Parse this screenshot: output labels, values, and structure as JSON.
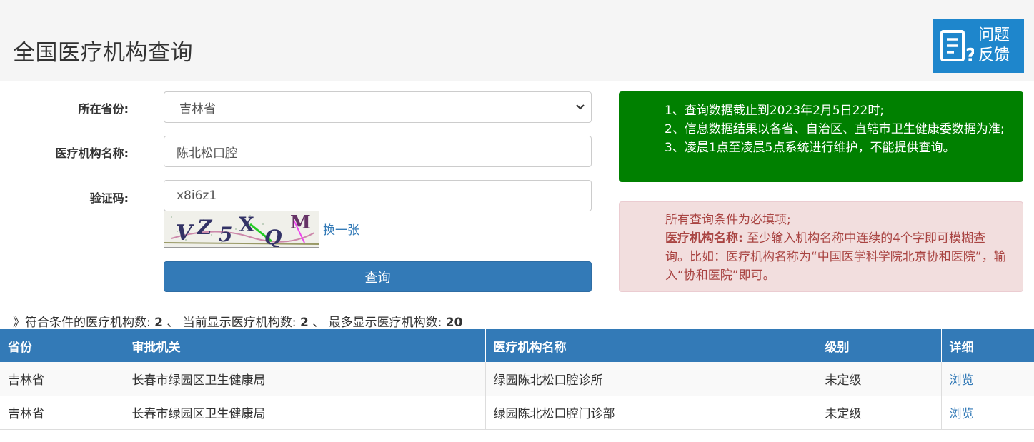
{
  "header": {
    "title": "全国医疗机构查询",
    "feedback_line1": "问题",
    "feedback_line2": "反馈"
  },
  "form": {
    "province_label": "所在省份:",
    "province_value": "吉林省",
    "name_label": "医疗机构名称:",
    "name_value": "陈北松口腔",
    "captcha_label": "验证码:",
    "captcha_value": "x8i6z1",
    "captcha_image_text": [
      "V",
      "Z",
      "5",
      "X",
      "Q",
      "M"
    ],
    "refresh_label": "换一张",
    "submit_label": "查询"
  },
  "notice_info": {
    "line1": "1、查询数据截止到2023年2月5日22时;",
    "line2": "2、信息数据结果以各省、自治区、直辖市卫生健康委数据为准;",
    "line3": "3、凌晨1点至凌晨5点系统进行维护，不能提供查询。"
  },
  "notice_warn": {
    "line1": "所有查询条件为必填项;",
    "bold_label": "医疗机构名称:",
    "text": "至少输入机构名称中连续的4个字即可模糊查询。比如：医疗机构名称为“中国医学科学院北京协和医院”，输入“协和医院”即可。"
  },
  "summary": {
    "prefix": "》符合条件的医疗机构数:",
    "matched": "2",
    "sep1": "、 当前显示医疗机构数:",
    "shown": "2",
    "sep2": "、 最多显示医疗机构数:",
    "max": "20"
  },
  "table": {
    "headers": [
      "省份",
      "审批机关",
      "医疗机构名称",
      "级别",
      "详细"
    ],
    "rows": [
      {
        "province": "吉林省",
        "authority": "长春市绿园区卫生健康局",
        "name": "绿园陈北松口腔诊所",
        "level": "未定级",
        "detail": "浏览"
      },
      {
        "province": "吉林省",
        "authority": "长春市绿园区卫生健康局",
        "name": "绿园陈北松口腔门诊部",
        "level": "未定级",
        "detail": "浏览"
      }
    ]
  },
  "colors": {
    "primary": "#337ab7",
    "feedback_bg": "#1e86cc",
    "notice_green": "#008000",
    "notice_red_bg": "#f2dede",
    "notice_red_text": "#a94442"
  },
  "icons": {
    "feedback": "feedback-doc-icon",
    "select": "chevron-down-icon"
  }
}
